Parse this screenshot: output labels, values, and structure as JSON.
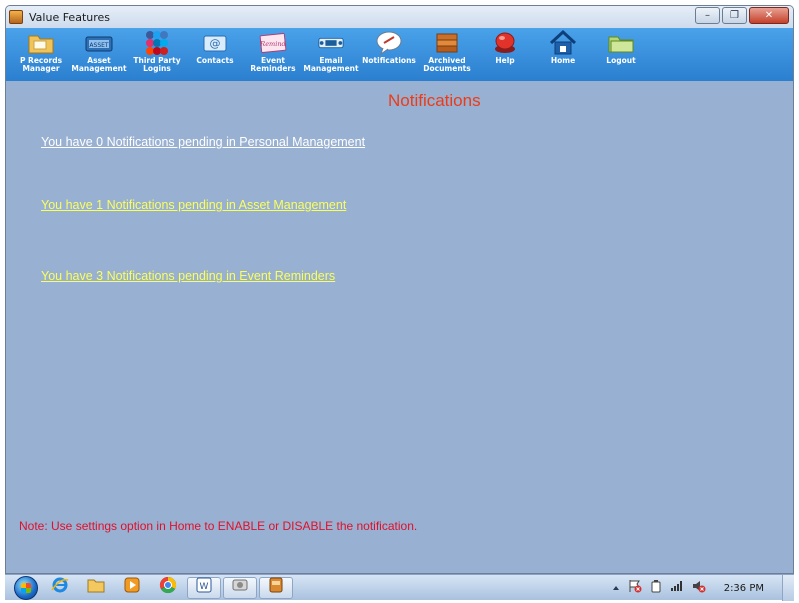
{
  "window": {
    "title": "Value Features",
    "controls": {
      "minimize": "–",
      "maximize": "❐",
      "close": "✕"
    }
  },
  "toolbar": {
    "items": [
      {
        "label": "P Records\nManager",
        "icon": "folder-icon"
      },
      {
        "label": "Asset\nManagement",
        "icon": "asset-icon"
      },
      {
        "label": "Third Party\nLogins",
        "icon": "social-icons-icon"
      },
      {
        "label": "Contacts",
        "icon": "contacts-icon"
      },
      {
        "label": "Event\nReminders",
        "icon": "reminder-icon"
      },
      {
        "label": "Email\nManagement",
        "icon": "email-icon"
      },
      {
        "label": "Notifications",
        "icon": "notifications-icon"
      },
      {
        "label": "Archived\nDocuments",
        "icon": "archive-icon"
      },
      {
        "label": "Help",
        "icon": "help-icon"
      },
      {
        "label": "Home",
        "icon": "home-icon"
      },
      {
        "label": "Logout",
        "icon": "logout-icon"
      }
    ]
  },
  "main": {
    "title": "Notifications",
    "links": [
      {
        "text": "You have 0 Notifications pending in Personal Management",
        "color": "#ffffff"
      },
      {
        "text": "You have 1 Notifications pending in Asset Management",
        "color": "#fbff5a"
      },
      {
        "text": "You have 3 Notifications pending in Event Reminders",
        "color": "#fbff5a"
      }
    ],
    "note": "Note: Use settings option in Home to ENABLE or DISABLE the notification."
  },
  "taskbar": {
    "clock": "2:36 PM",
    "pinned": [
      "ie-icon",
      "explorer-icon",
      "media-player-icon",
      "chrome-icon",
      "word-icon",
      "app-icon",
      "value-features-icon"
    ]
  },
  "colors": {
    "toolbar": "#2b7fcf",
    "content_bg": "#98b0d1",
    "title_color": "#ee3b17",
    "note_color": "#e0102b"
  }
}
